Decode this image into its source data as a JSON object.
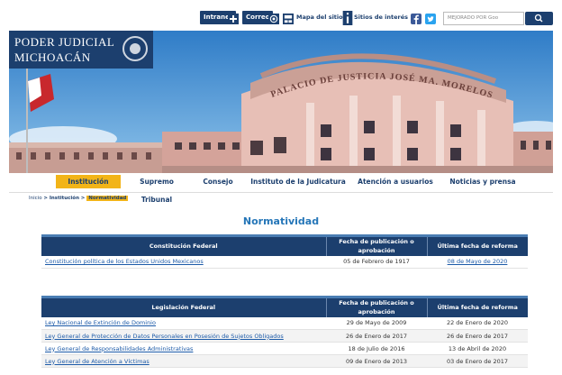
{
  "topbar": {
    "intranet": "Intranet",
    "correo": "Correo",
    "mapa": "Mapa del sitio",
    "sitios": "Sitios de interés",
    "search_placeholder": "MEJORADO POR Goo"
  },
  "brand": {
    "line1": "PODER JUDICIAL",
    "line2": "MICHOACÁN"
  },
  "banner": {
    "inscription": "PALACIO DE JUSTICIA JOSÉ MA. MORELOS"
  },
  "nav": {
    "items": [
      "Institución",
      "Supremo Tribunal",
      "Consejo",
      "Instituto de la Judicatura",
      "Atención a usuarios",
      "Noticias y prensa"
    ]
  },
  "breadcrumb": {
    "home": "Inicio",
    "section": "Institución",
    "current": "Normatividad"
  },
  "page_title": "Normatividad",
  "table1": {
    "headers": [
      "Constitución Federal",
      "Fecha de publicación o aprobación",
      "Última fecha de reforma"
    ],
    "rows": [
      [
        "Constitución política de los Estados Unidos Mexicanos",
        "05 de Febrero de 1917",
        "08 de Mayo de 2020"
      ]
    ]
  },
  "table2": {
    "headers": [
      "Legislación Federal",
      "Fecha de publicación o aprobación",
      "Última fecha de reforma"
    ],
    "rows": [
      [
        "Ley Nacional de Extinción de Dominio",
        "29 de Mayo de 2009",
        "22 de Enero de 2020"
      ],
      [
        "Ley General de Protección de Datos Personales en Posesión de Sujetos Obligados",
        "26 de Enero de 2017",
        "26 de Enero de 2017"
      ],
      [
        "Ley General de Responsabilidades Administrativas",
        "18 de Julio de 2016",
        "13 de Abril de 2020"
      ],
      [
        "Ley General de Atención a Víctimas",
        "09 de Enero de 2013",
        "03 de Enero de 2017"
      ]
    ]
  },
  "colors": {
    "primary": "#1c3f6e",
    "accent": "#f2b418",
    "title": "#2576b8",
    "link": "#1c5aa8"
  }
}
